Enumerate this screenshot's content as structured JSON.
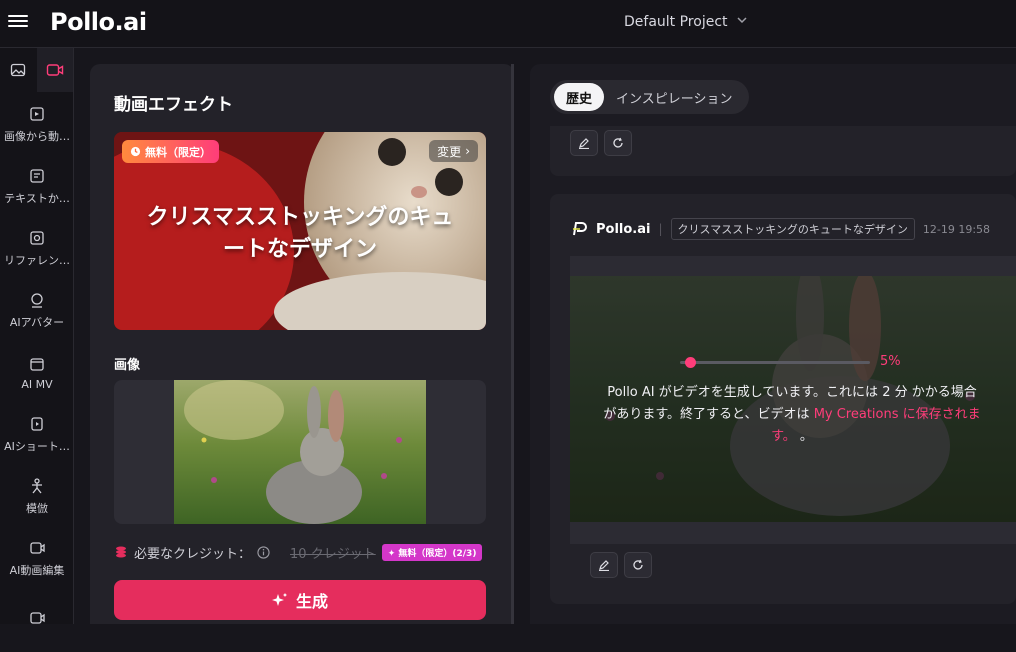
{
  "app": {
    "logo": "Pollo.ai",
    "project_name": "Default Project"
  },
  "sidebar": {
    "items": [
      {
        "label": "画像から動…",
        "icon": "image-video-icon"
      },
      {
        "label": "テキストか…",
        "icon": "text-video-icon"
      },
      {
        "label": "リファレン…",
        "icon": "reference-icon"
      },
      {
        "label": "AIアバター",
        "icon": "avatar-icon"
      },
      {
        "label": "AI MV",
        "icon": "mv-icon"
      },
      {
        "label": "AIショート…",
        "icon": "short-video-icon"
      },
      {
        "label": "模倣",
        "icon": "mimic-icon"
      },
      {
        "label": "AI動画編集",
        "icon": "video-edit-icon"
      },
      {
        "label": "",
        "icon": "more-icon"
      }
    ]
  },
  "left": {
    "title": "動画エフェクト",
    "effect": {
      "badge": "無料（限定）",
      "change_label": "変更",
      "title_line1": "クリスマスストッキングのキュ",
      "title_line2": "ートなデザイン"
    },
    "image_label": "画像",
    "credits": {
      "label": "必要なクレジット：",
      "original": "10 クレジット",
      "free_badge": "無料（限定）(2/3)"
    },
    "generate_label": "生成"
  },
  "right": {
    "tabs": [
      {
        "label": "歴史",
        "active": true
      },
      {
        "label": "インスピレーション",
        "active": false
      }
    ],
    "card": {
      "brand": "Pollo.ai",
      "prompt": "クリスマスストッキングのキュートなデザイン",
      "timestamp": "12-19 19:58",
      "progress": 0.05,
      "progress_label": "5%",
      "message_part1": "Pollo AI がビデオを生成しています。これには 2 分 かかる場合があります。終了すると、ビデオは",
      "message_link": "My Creations に保存されます。",
      "message_part2": "。"
    }
  },
  "colors": {
    "accent": "#e52d5d",
    "highlight": "#ff3d7a",
    "badge_purple": "#d437c9"
  }
}
